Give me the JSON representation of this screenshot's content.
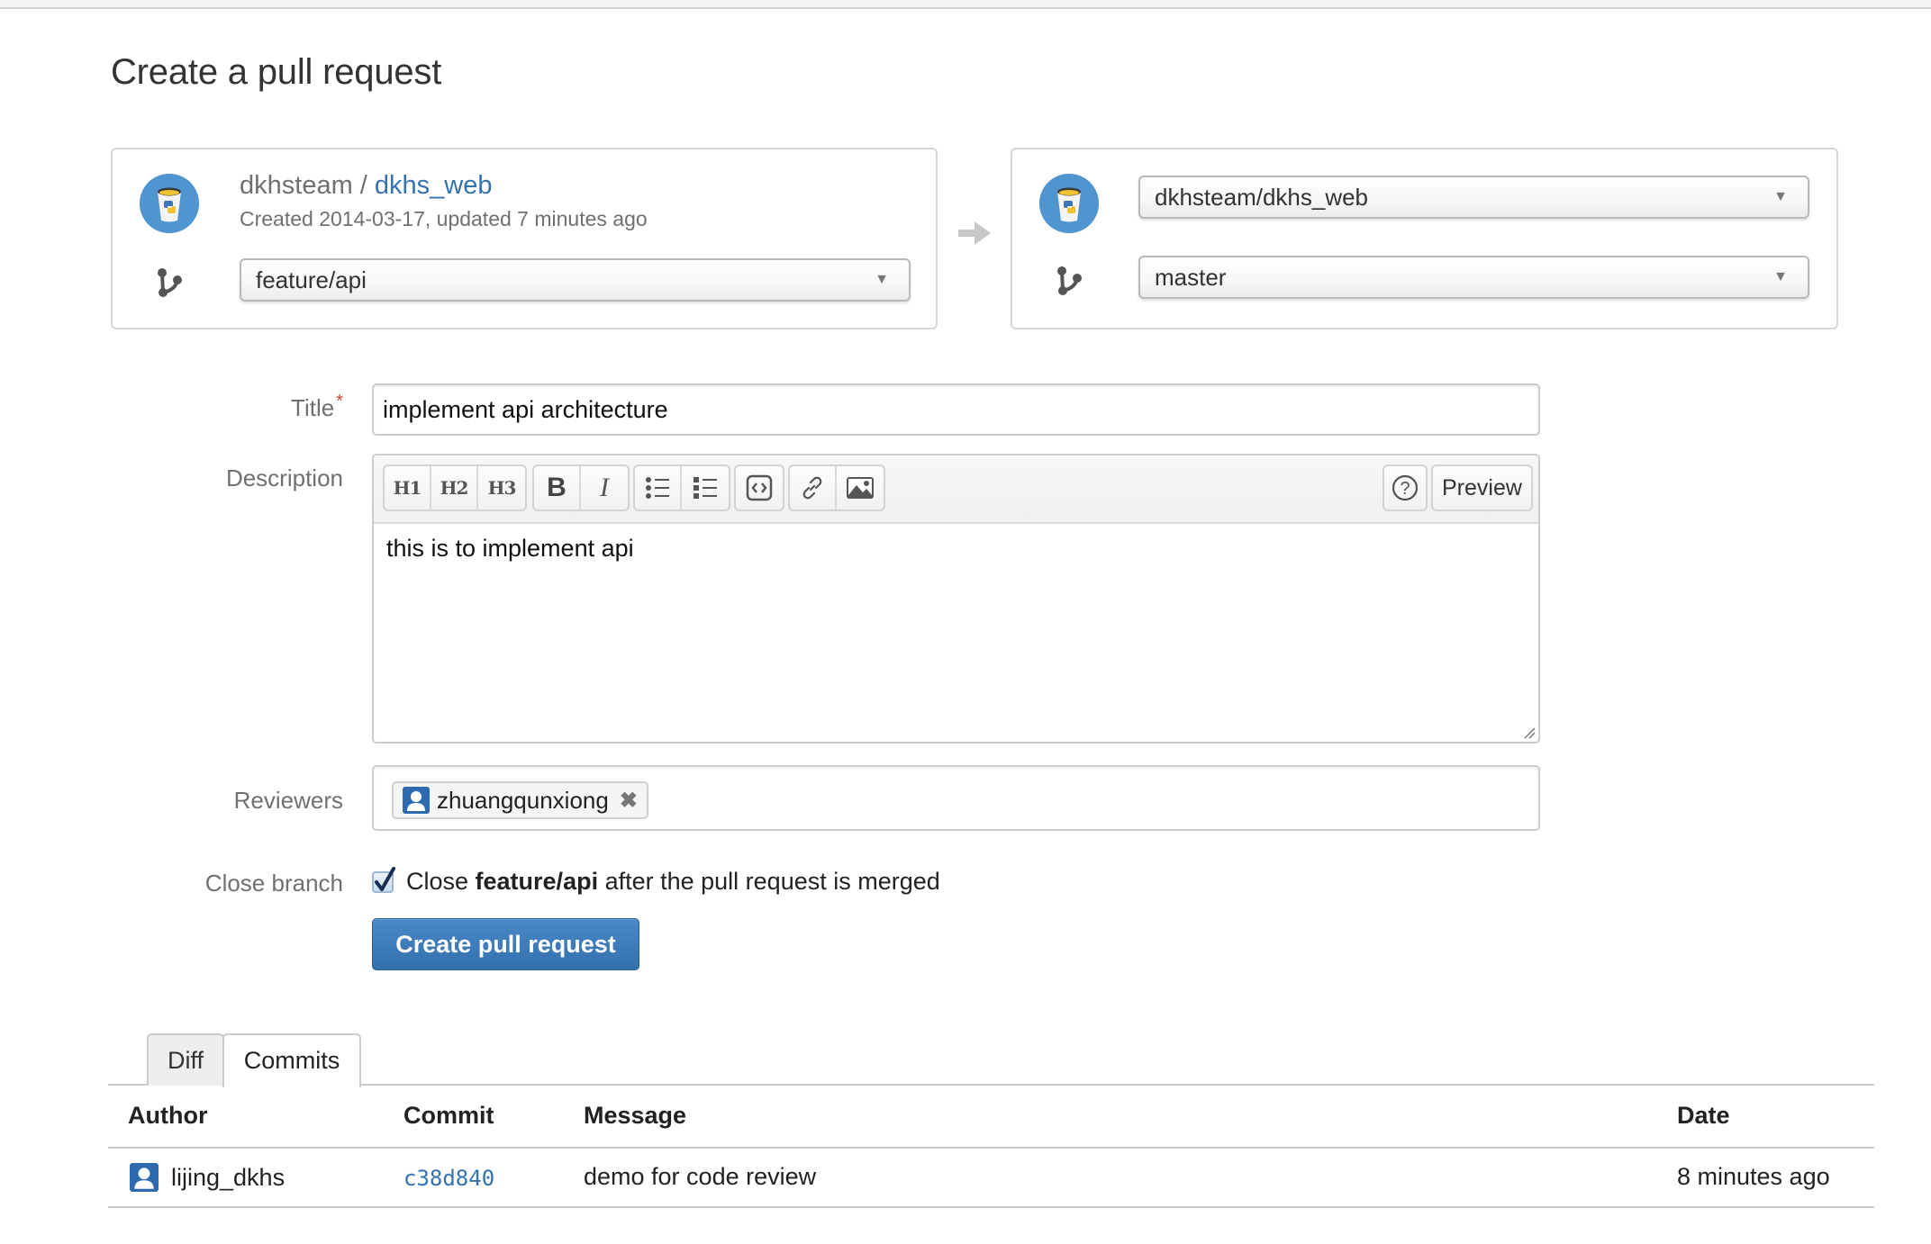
{
  "page": {
    "title": "Create a pull request"
  },
  "source": {
    "owner": "dkhsteam",
    "separator": " / ",
    "repo": "dkhs_web",
    "meta": "Created 2014-03-17, updated 7 minutes ago",
    "branch": "feature/api",
    "avatar_icon": "python-bucket-avatar-icon",
    "branch_icon": "branch-icon"
  },
  "direction_icon": "arrow-right-icon",
  "target": {
    "repo": "dkhsteam/dkhs_web",
    "branch": "master",
    "avatar_icon": "python-bucket-avatar-icon",
    "branch_icon": "branch-icon"
  },
  "form": {
    "title_label": "Title",
    "required_marker": "*",
    "title_value": "implement api architecture",
    "description_label": "Description",
    "description_value": "this is to implement api",
    "toolbar": {
      "h1": "H1",
      "h2": "H2",
      "h3": "H3",
      "bold": "B",
      "italic": "I",
      "bullet_list_icon": "bullet-list-icon",
      "numbered_list_icon": "numbered-list-icon",
      "code_icon": "code-icon",
      "link_icon": "link-icon",
      "image_icon": "image-icon",
      "help_icon": "help-icon",
      "preview": "Preview"
    },
    "reviewers_label": "Reviewers",
    "reviewers": [
      {
        "name": "zhuangqunxiong",
        "icon": "user-icon",
        "remove_icon": "remove-icon"
      }
    ],
    "close_branch_label": "Close branch",
    "close_branch_checked": true,
    "close_branch_text_prefix": "Close ",
    "close_branch_text_branch": "feature/api",
    "close_branch_text_suffix": " after the pull request is merged",
    "submit_label": "Create pull request"
  },
  "tabs": [
    {
      "label": "Diff",
      "active": false
    },
    {
      "label": "Commits",
      "active": true
    }
  ],
  "commits_table": {
    "columns": [
      "Author",
      "Commit",
      "Message",
      "Date"
    ],
    "rows": [
      {
        "author": "lijing_dkhs",
        "commit": "c38d840",
        "message": "demo for code review",
        "date": "8 minutes ago"
      }
    ]
  },
  "colors": {
    "link": "#3572b0",
    "primary_button": "#3572b0",
    "required": "#d04437"
  }
}
